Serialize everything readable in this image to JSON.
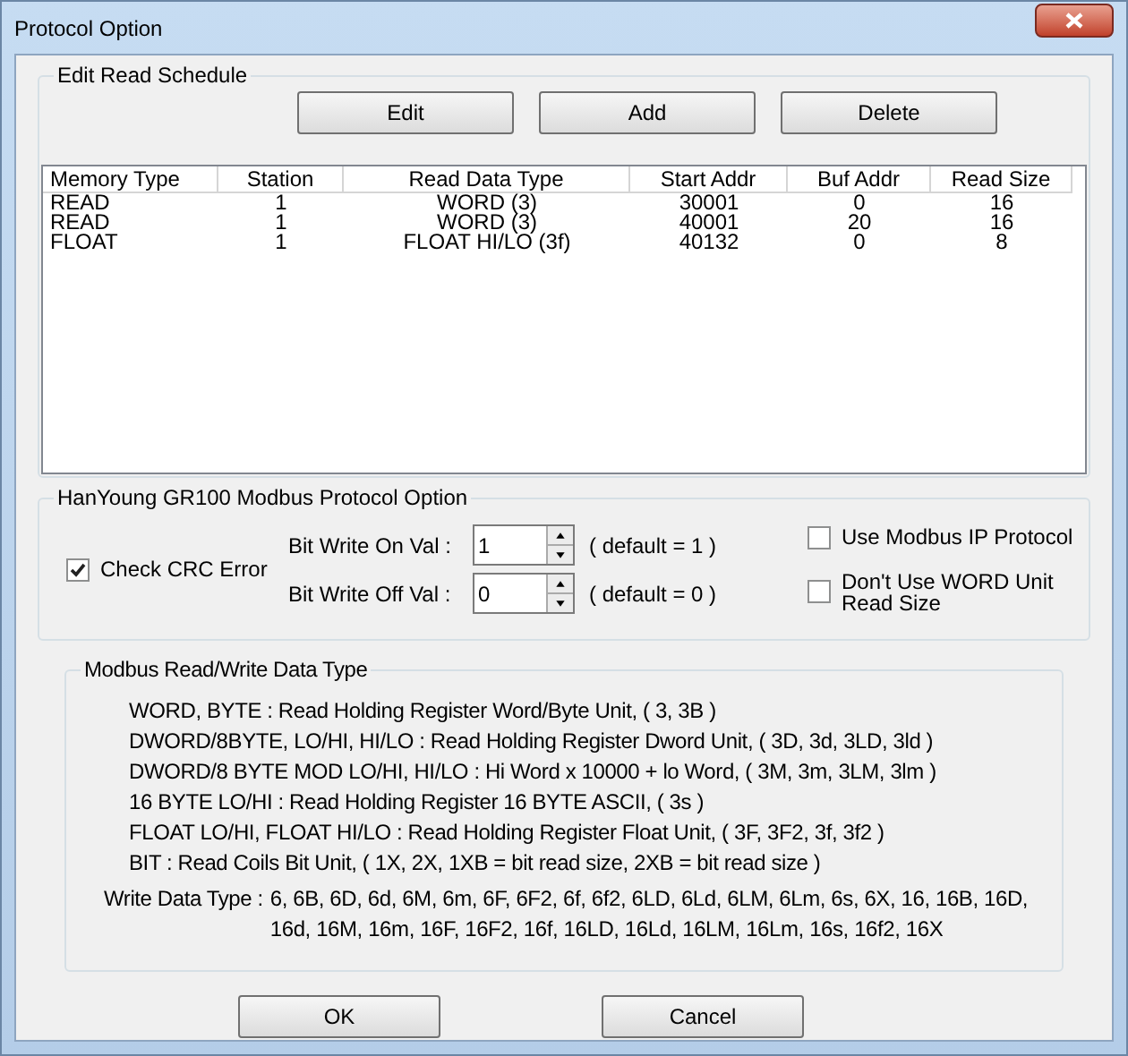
{
  "window": {
    "title": "Protocol Option"
  },
  "schedule": {
    "title": "Edit Read Schedule",
    "buttons": [
      "Edit",
      "Add",
      "Delete"
    ],
    "columns": [
      "Memory Type",
      "Station",
      "Read Data Type",
      "Start Addr",
      "Buf Addr",
      "Read Size"
    ],
    "rows": [
      [
        "READ",
        "1",
        "WORD (3)",
        "30001",
        "0",
        "16"
      ],
      [
        "READ",
        "1",
        "WORD (3)",
        "40001",
        "20",
        "16"
      ],
      [
        "FLOAT",
        "1",
        "FLOAT HI/LO (3f)",
        "40132",
        "0",
        "8"
      ]
    ]
  },
  "option": {
    "title": "HanYoung GR100 Modbus Protocol Option",
    "check_crc": {
      "label": "Check CRC Error",
      "checked": true
    },
    "spinners": [
      {
        "label": "Bit Write On Val :",
        "value": "1",
        "hint": "( default = 1 )"
      },
      {
        "label": "Bit Write Off Val :",
        "value": "0",
        "hint": "( default = 0 )"
      }
    ],
    "checkboxes": [
      {
        "label": "Use Modbus IP Protocol",
        "checked": false
      },
      {
        "label": "Don't Use WORD Unit Read Size",
        "checked": false
      }
    ]
  },
  "types": {
    "title": "Modbus Read/Write Data Type",
    "lines": [
      "WORD, BYTE : Read Holding Register Word/Byte Unit, ( 3, 3B )",
      "DWORD/8BYTE, LO/HI, HI/LO : Read Holding Register Dword Unit, ( 3D, 3d, 3LD, 3ld )",
      "DWORD/8 BYTE MOD LO/HI, HI/LO : Hi Word x 10000 + lo Word, ( 3M, 3m, 3LM, 3lm )",
      "16 BYTE LO/HI : Read Holding Register 16 BYTE ASCII, ( 3s )",
      "FLOAT LO/HI, FLOAT HI/LO : Read Holding Register Float Unit, ( 3F, 3F2, 3f, 3f2 )",
      "BIT : Read Coils Bit Unit, ( 1X, 2X, 1XB = bit read size, 2XB = bit read size )"
    ],
    "write_label": "Write Data Type :",
    "write_value": "6, 6B, 6D, 6d, 6M, 6m, 6F, 6F2, 6f, 6f2, 6LD, 6Ld, 6LM, 6Lm, 6s, 6X, 16, 16B, 16D, 16d, 16M, 16m, 16F, 16F2, 16f, 16LD, 16Ld, 16LM, 16Lm, 16s, 16f2, 16X"
  },
  "buttons": [
    "OK",
    "Cancel"
  ]
}
